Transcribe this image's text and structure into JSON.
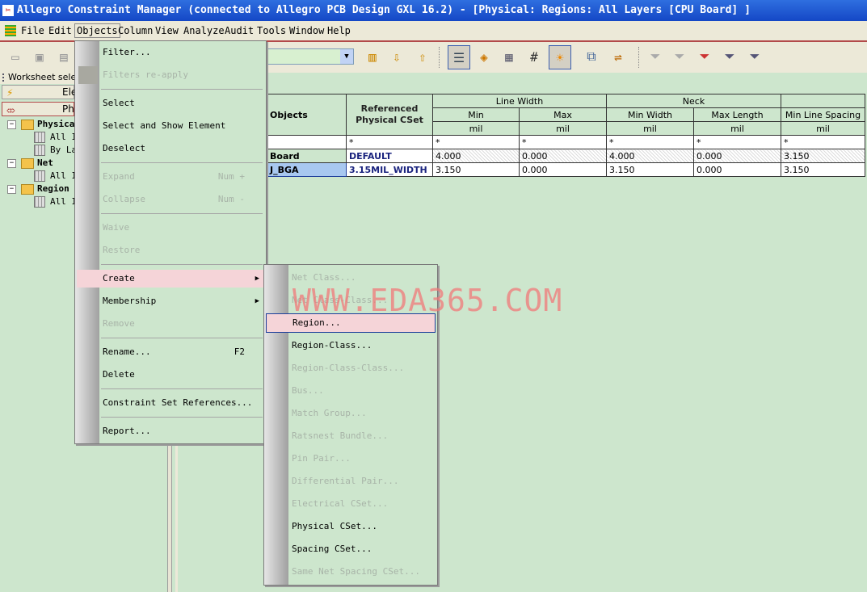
{
  "window": {
    "title": "Allegro Constraint Manager (connected to Allegro PCB Design GXL 16.2) - [Physical:  Regions:  All Layers [CPU Board] ]"
  },
  "menubar": [
    "File",
    "Edit",
    "Objects",
    "Column",
    "View",
    "Analyze",
    "Audit",
    "Tools",
    "Window",
    "Help"
  ],
  "left_panel": {
    "worksheet_selector": "Worksheet selec",
    "tabs": [
      "Ele",
      "Ph"
    ],
    "tree": {
      "physical": {
        "label": "Physica",
        "items": [
          "All I",
          "By La"
        ]
      },
      "net": {
        "label": "Net",
        "items": [
          "All I"
        ]
      },
      "region": {
        "label": "Region",
        "items": [
          "All I"
        ]
      }
    }
  },
  "table": {
    "headers": {
      "objects": "Objects",
      "ref_cset": "Referenced Physical CSet",
      "line_width": "Line Width",
      "neck": "Neck",
      "min": "Min",
      "max": "Max",
      "min_width": "Min Width",
      "max_length": "Max Length",
      "min_line_spacing": "Min Line Spacing",
      "unit": "mil",
      "filter": "*"
    },
    "rows": [
      {
        "object": "Board",
        "cset": "DEFAULT",
        "min": "4.000",
        "max": "0.000",
        "min_width": "4.000",
        "max_length": "0.000",
        "spacing": "3.150"
      },
      {
        "object": "J_BGA",
        "cset": "3.15MIL_WIDTH",
        "min": "3.150",
        "max": "0.000",
        "min_width": "3.150",
        "max_length": "0.000",
        "spacing": "3.150"
      }
    ]
  },
  "objects_menu": {
    "filter": "Filter...",
    "filters_reapply": "Filters re-apply",
    "select": "Select",
    "select_show": "Select and Show Element",
    "deselect": "Deselect",
    "expand": "Expand",
    "expand_sc": "Num +",
    "collapse": "Collapse",
    "collapse_sc": "Num -",
    "waive": "Waive",
    "restore": "Restore",
    "create": "Create",
    "membership": "Membership",
    "remove": "Remove",
    "rename": "Rename...",
    "rename_sc": "F2",
    "delete": "Delete",
    "cset_refs": "Constraint Set References...",
    "report": "Report..."
  },
  "create_menu": {
    "net_class": "Net Class...",
    "net_class_class": "Net Class-Class...",
    "region": "Region...",
    "region_class": "Region-Class...",
    "region_class_class": "Region-Class-Class...",
    "bus": "Bus...",
    "match_group": "Match Group...",
    "ratsnest_bundle": "Ratsnest Bundle...",
    "pin_pair": "Pin Pair...",
    "diff_pair": "Differential Pair...",
    "electrical_cset": "Electrical CSet...",
    "physical_cset": "Physical CSet...",
    "spacing_cset": "Spacing CSet...",
    "same_net_spacing_cset": "Same Net Spacing CSet..."
  },
  "watermark": "WWW.EDA365.COM",
  "colors": {
    "title": "#1447c6",
    "menu_bg": "#cde6cd",
    "highlight": "#f5d4d8"
  }
}
